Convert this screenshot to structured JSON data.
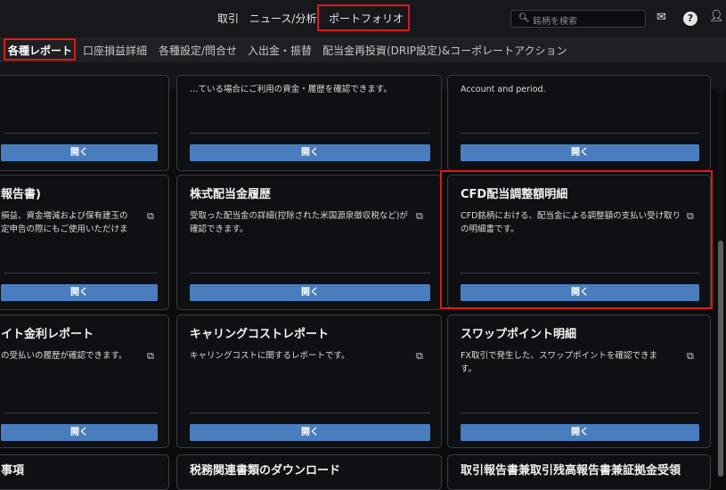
{
  "header": {
    "nav": [
      "取引",
      "ニュース/分析",
      "ポートフォリオ"
    ],
    "search_placeholder": "銘柄を検索",
    "icons": {
      "search": "search-icon",
      "mail": "mail-icon",
      "help": "help-icon",
      "user": "user-icon"
    }
  },
  "subnav": {
    "tabs": [
      "各種レポート",
      "口座損益詳細",
      "各種設定/問合せ",
      "入出金・振替",
      "配当金再投資(DRIP設定)&コーポレートアクション"
    ],
    "active": "各種レポート"
  },
  "cards": {
    "row0_mid_desc": "…ている場合にご利用の資金・履歴を確認できます。",
    "row0_right_desc": "Account and period.",
    "row1_left": {
      "title": "報告書)",
      "desc": "損益、資金増減および保有建玉の\n定申告の際にもご使用いただけま"
    },
    "row1_mid": {
      "title": "株式配当金履歴",
      "desc": "受取った配当金の詳細(控除された米国源泉徴収税など)が確認できます。"
    },
    "row1_right": {
      "title": "CFD配当調整額明細",
      "desc": "CFD銘柄における、配当金による調整額の支払い受け取りの明細書です。"
    },
    "row2_left": {
      "title": "イト金利レポート",
      "desc": "の受払いの履歴が確認できます。"
    },
    "row2_mid": {
      "title": "キャリングコストレポート",
      "desc": "キャリングコストに関するレポートです。"
    },
    "row2_right": {
      "title": "スワップポイント明細",
      "desc": "FX取引で発生した、スワップポイントを確認できます。"
    },
    "row3_left": {
      "title": "事項"
    },
    "row3_mid": {
      "title": "税務関連書類のダウンロード"
    },
    "row3_right": {
      "title": "取引報告書兼取引残高報告書兼証拠金受領"
    },
    "open_label": "開く"
  },
  "colors": {
    "accent": "#4a7dbd",
    "highlight": "#e01818",
    "background": "#0b0b0d"
  }
}
